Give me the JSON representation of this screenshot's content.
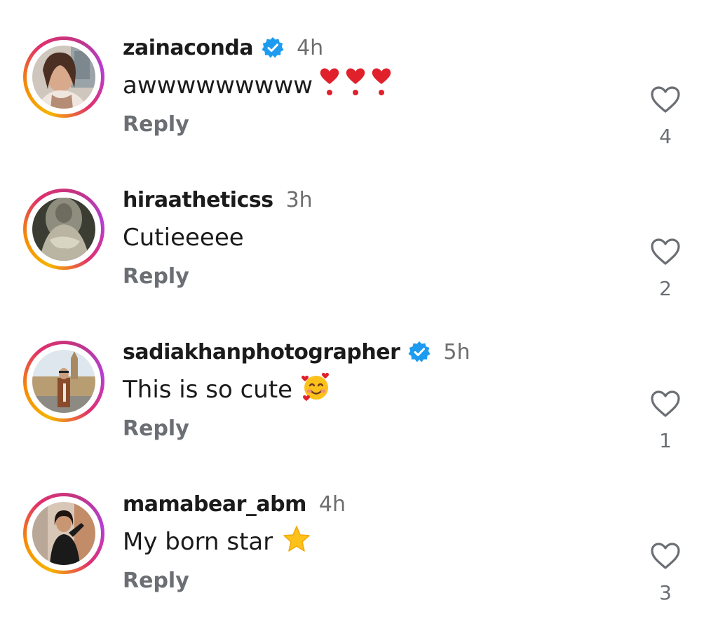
{
  "comments": [
    {
      "username": "zainaconda",
      "verified": true,
      "time": "4h",
      "text": "awwwwwwwww",
      "emoji": "red-heart-exclamation x3",
      "reply_label": "Reply",
      "likes": "4"
    },
    {
      "username": "hiraatheticss",
      "verified": false,
      "time": "3h",
      "text": "Cutieeeee",
      "emoji": "",
      "reply_label": "Reply",
      "likes": "2"
    },
    {
      "username": "sadiakhanphotographer",
      "verified": true,
      "time": "5h",
      "text": "This is so cute",
      "emoji": "smiling-face-with-hearts",
      "reply_label": "Reply",
      "likes": "1"
    },
    {
      "username": "mamabear_abm",
      "verified": false,
      "time": "4h",
      "text": "My born star",
      "emoji": "star",
      "reply_label": "Reply",
      "likes": "3"
    }
  ],
  "colors": {
    "verified_badge": "#1d9bf0",
    "heart_emoji": "#e0202a",
    "star_emoji": "#fcc21b",
    "muted_text": "#6b6f74"
  }
}
